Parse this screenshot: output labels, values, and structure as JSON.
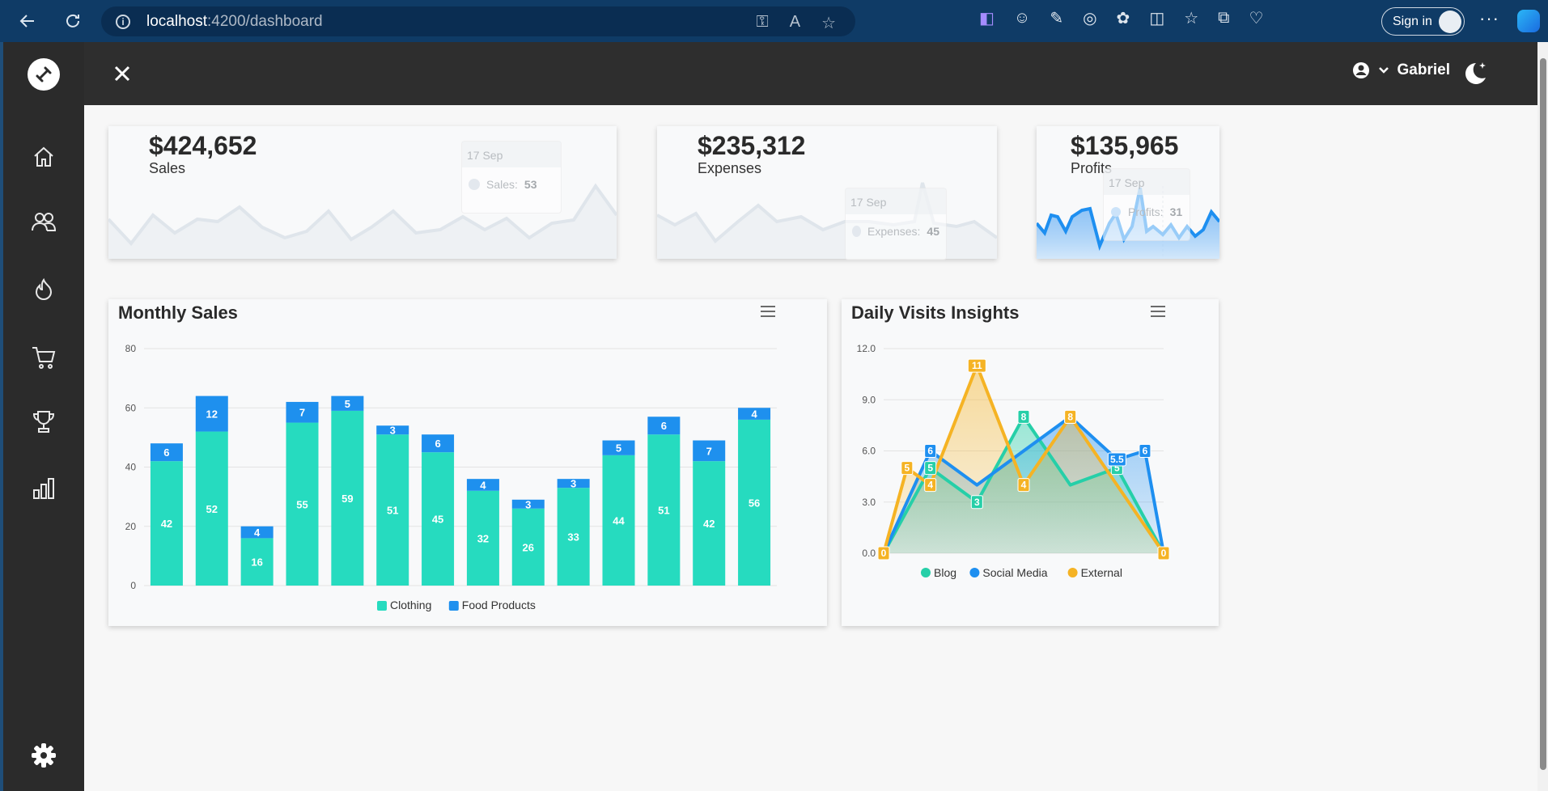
{
  "browser": {
    "url_host": "localhost",
    "url_path": ":4200/dashboard",
    "signin_label": "Sign in"
  },
  "header": {
    "username": "Gabriel"
  },
  "stats": [
    {
      "value": "$424,652",
      "label": "Sales",
      "tooltip_date": "17 Sep",
      "tooltip_series": "Sales:",
      "tooltip_value": "53"
    },
    {
      "value": "$235,312",
      "label": "Expenses",
      "tooltip_date": "17 Sep",
      "tooltip_series": "Expenses:",
      "tooltip_value": "45"
    },
    {
      "value": "$135,965",
      "label": "Profits",
      "tooltip_date": "17 Sep",
      "tooltip_series": "Profits:",
      "tooltip_value": "31"
    }
  ],
  "panels": {
    "monthly_title": "Monthly Sales",
    "daily_title": "Daily Visits Insights"
  },
  "chart_data": [
    {
      "type": "bar",
      "title": "Monthly Sales",
      "stacked": true,
      "ylim": [
        0,
        80
      ],
      "yticks": [
        "0",
        "20",
        "40",
        "60",
        "80"
      ],
      "legend_position": "bottom",
      "series": [
        {
          "name": "Clothing",
          "color": "#26dbbf",
          "values": [
            42,
            52,
            16,
            55,
            59,
            51,
            45,
            32,
            26,
            33,
            44,
            51,
            42,
            56
          ]
        },
        {
          "name": "Food Products",
          "color": "#1e90ee",
          "values": [
            6,
            12,
            4,
            7,
            5,
            3,
            6,
            4,
            3,
            3,
            5,
            6,
            7,
            4
          ]
        }
      ]
    },
    {
      "type": "area",
      "title": "Daily Visits Insights",
      "ylim": [
        0,
        12
      ],
      "yticks": [
        "0.0",
        "3.0",
        "6.0",
        "9.0",
        "12.0"
      ],
      "legend_position": "bottom",
      "series": [
        {
          "name": "Blog",
          "color": "#26cfa8",
          "points": [
            [
              0,
              0
            ],
            [
              1,
              5
            ],
            [
              2,
              3
            ],
            [
              3,
              8
            ],
            [
              4,
              4
            ],
            [
              5,
              5
            ],
            [
              6,
              0
            ]
          ]
        },
        {
          "name": "Social Media",
          "color": "#1e8ff0",
          "points": [
            [
              0,
              0
            ],
            [
              1,
              6
            ],
            [
              2,
              4
            ],
            [
              4,
              8
            ],
            [
              5,
              5.5
            ],
            [
              5.6,
              6
            ],
            [
              6,
              0
            ]
          ]
        },
        {
          "name": "External",
          "color": "#f5b324",
          "points": [
            [
              0,
              0
            ],
            [
              0.5,
              5
            ],
            [
              1,
              4
            ],
            [
              2,
              11
            ],
            [
              3,
              4
            ],
            [
              4,
              8
            ],
            [
              6,
              0
            ]
          ]
        }
      ],
      "labels": [
        {
          "series": "Blog",
          "text": "5"
        },
        {
          "series": "Blog",
          "text": "3"
        },
        {
          "series": "Blog",
          "text": "8"
        },
        {
          "series": "Blog",
          "text": "5"
        },
        {
          "series": "Social Media",
          "text": "6"
        },
        {
          "series": "Social Media",
          "text": "8"
        },
        {
          "series": "Social Media",
          "text": "5.5"
        },
        {
          "series": "Social Media",
          "text": "6"
        },
        {
          "series": "External",
          "text": "0"
        },
        {
          "series": "External",
          "text": "5"
        },
        {
          "series": "External",
          "text": "4"
        },
        {
          "series": "External",
          "text": "11"
        },
        {
          "series": "External",
          "text": "4"
        },
        {
          "series": "External",
          "text": "8"
        },
        {
          "series": "External",
          "text": "0"
        }
      ]
    }
  ]
}
